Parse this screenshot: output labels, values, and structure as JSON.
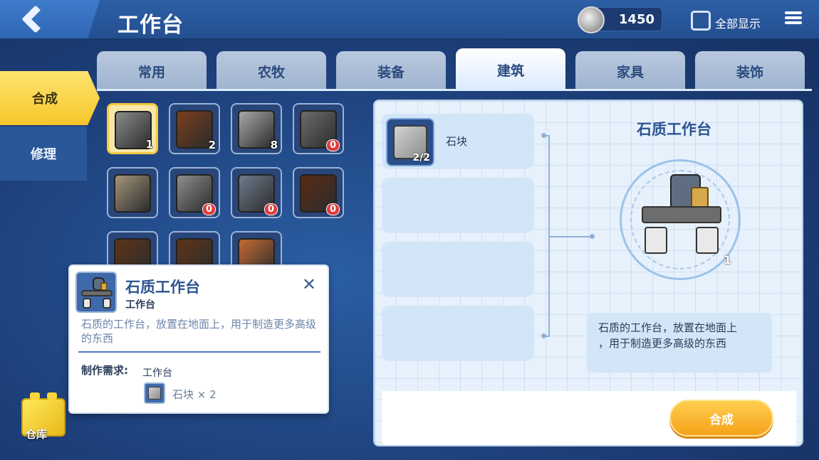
{
  "header": {
    "title": "工作台",
    "currency_amount": "1450",
    "show_all_label": "全部显示"
  },
  "side_tabs": [
    {
      "label": "合成",
      "active": true
    },
    {
      "label": "修理",
      "active": false
    }
  ],
  "storage_label": "仓库",
  "category_tabs": [
    {
      "label": "常用",
      "active": false
    },
    {
      "label": "农牧",
      "active": false
    },
    {
      "label": "装备",
      "active": false
    },
    {
      "label": "建筑",
      "active": true
    },
    {
      "label": "家具",
      "active": false
    },
    {
      "label": "装饰",
      "active": false
    }
  ],
  "grid_items": [
    {
      "icon": "stone-workbench-icon",
      "count": "1",
      "selected": true,
      "color": "#8a8a8a"
    },
    {
      "icon": "wooden-window-icon",
      "count": "2",
      "selected": false,
      "color": "#7a3f1c"
    },
    {
      "icon": "stone-block-icon",
      "count": "8",
      "selected": false,
      "color": "#a8a8a8"
    },
    {
      "icon": "dark-stone-block-icon",
      "count": "0",
      "selected": false,
      "color": "#6c6c6c"
    },
    {
      "icon": "sand-block-icon",
      "count": "",
      "selected": false,
      "color": "#a4957a"
    },
    {
      "icon": "gravel-block-icon",
      "count": "0",
      "selected": false,
      "color": "#8e8e8e"
    },
    {
      "icon": "slate-block-icon",
      "count": "0",
      "selected": false,
      "color": "#6e7b8c"
    },
    {
      "icon": "lattice-window-icon",
      "count": "0",
      "selected": false,
      "color": "#5a2b14"
    },
    {
      "icon": "wooden-door-icon",
      "count": "",
      "selected": false,
      "color": "#5c3418"
    },
    {
      "icon": "wooden-door-icon",
      "count": "",
      "selected": false,
      "color": "#5c3418"
    },
    {
      "icon": "clay-block-icon",
      "count": "",
      "selected": false,
      "color": "#c56a32"
    }
  ],
  "materials": [
    {
      "name": "石块",
      "count": "2/2",
      "icon": "stone-block-icon"
    }
  ],
  "result": {
    "title": "石质工作台",
    "count": "1",
    "description_line1": "石质的工作台，放置在地面上",
    "description_line2": "，用于制造更多高级的东西"
  },
  "craft_button_label": "合成",
  "tooltip": {
    "title": "石质工作台",
    "subtitle": "工作台",
    "description": "石质的工作台，放置在地面上，用于制造更多高级的东西",
    "requirement_label": "制作需求:",
    "requirement_station": "工作台",
    "requirement_material": "石块 × 2"
  },
  "colors": {
    "accent_yellow": "#f5c629",
    "title_blue": "#2d5492",
    "craft_orange": "#f5a21a"
  }
}
